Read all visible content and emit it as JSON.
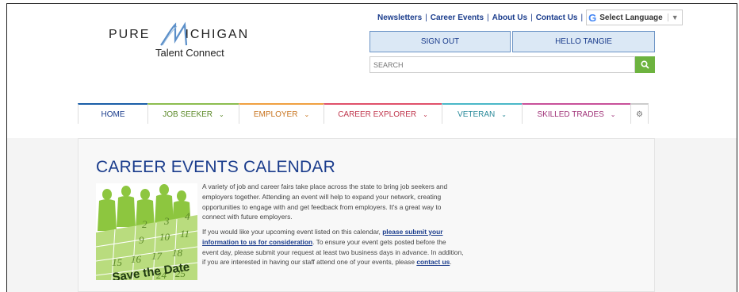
{
  "logo": {
    "brand_left": "PURE",
    "brand_right": "ICHIGAN",
    "subtitle": "Talent Connect"
  },
  "toplinks": {
    "items": [
      "Newsletters",
      "Career Events",
      "About Us",
      "Contact Us"
    ],
    "language_label": "Select Language",
    "language_arrow": "▼",
    "google_glyph": "G"
  },
  "account": {
    "signout_label": "SIGN OUT",
    "hello_label": "HELLO TANGIE"
  },
  "search": {
    "placeholder": "SEARCH"
  },
  "nav": {
    "items": [
      {
        "label": "HOME"
      },
      {
        "label": "JOB SEEKER"
      },
      {
        "label": "EMPLOYER"
      },
      {
        "label": "CAREER EXPLORER"
      },
      {
        "label": "VETERAN"
      },
      {
        "label": "SKILLED TRADES"
      }
    ],
    "chevron": "⌄",
    "gear_glyph": "⚙"
  },
  "content": {
    "title": "CAREER EVENTS CALENDAR",
    "paragraph1": "A variety of job and career fairs take place across the state to bring job seekers and employers together. Attending an event will help to expand your network, creating opportunities to engage with and get feedback from employers. It's a great way to connect with future employers.",
    "p2_part1": "If you would like your upcoming event listed on this calendar, ",
    "p2_link1": "please submit your information to us for consideration",
    "p2_part2": ". To ensure your event gets posted before the event day, please submit your request at least two business days in advance. In addition, if you are interested in having our staff attend one of your events, please ",
    "p2_link2": "contact us",
    "p2_part3": ".",
    "image_caption": "Save the Date",
    "image_numbers": [
      "2",
      "3",
      "4",
      "9",
      "10",
      "11",
      "15",
      "16",
      "17",
      "18",
      "24",
      "25"
    ]
  },
  "colors": {
    "brand_blue": "#1a3c8c",
    "search_green": "#6db33f",
    "image_green": "#8dc63f"
  }
}
